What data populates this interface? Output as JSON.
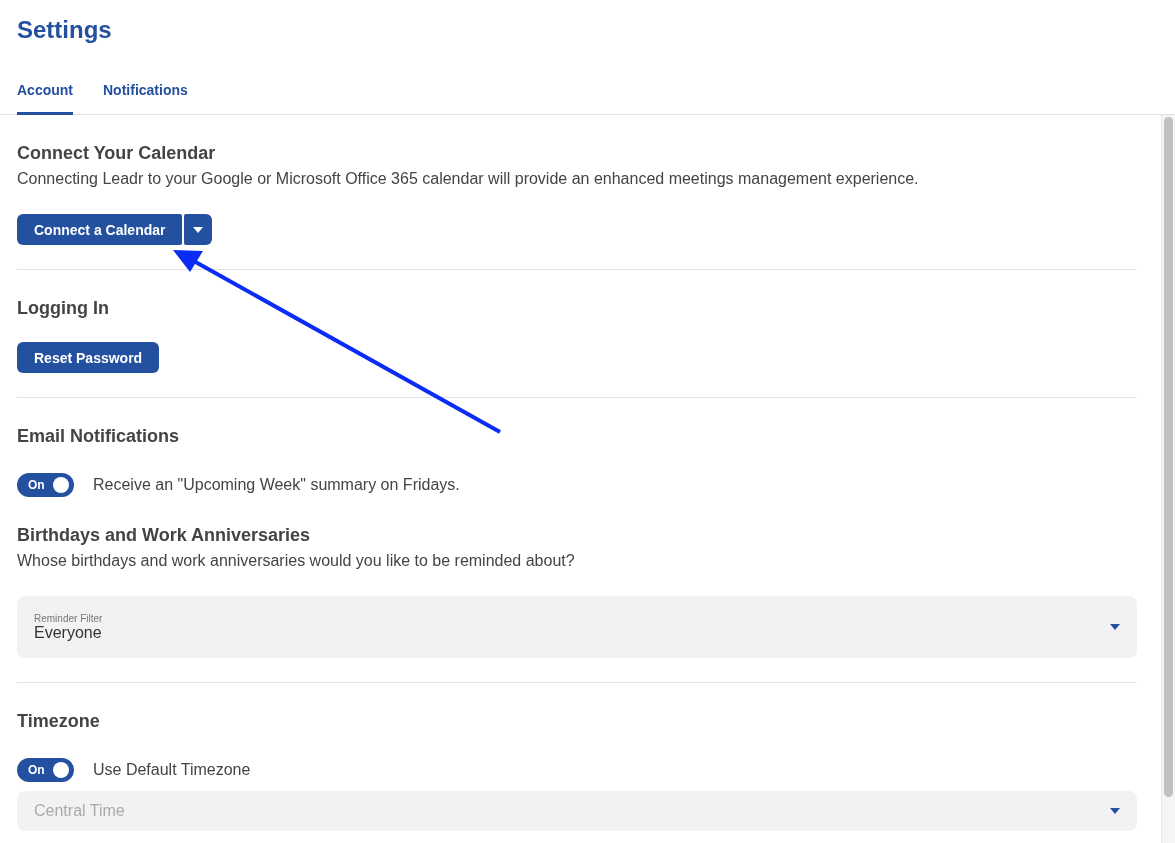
{
  "page": {
    "title": "Settings"
  },
  "tabs": [
    {
      "label": "Account",
      "selected": true
    },
    {
      "label": "Notifications",
      "selected": false
    }
  ],
  "calendar": {
    "heading": "Connect Your Calendar",
    "description": "Connecting Leadr to your Google or Microsoft Office 365 calendar will provide an enhanced meetings management experience.",
    "button": "Connect a Calendar"
  },
  "logging_in": {
    "heading": "Logging In",
    "button": "Reset Password"
  },
  "email_notifications": {
    "heading": "Email Notifications",
    "toggle": {
      "label": "On",
      "on": true
    },
    "toggle_text": "Receive an \"Upcoming Week\" summary on Fridays."
  },
  "birthdays": {
    "heading": "Birthdays and Work Anniversaries",
    "description": "Whose birthdays and work anniversaries would you like to be reminded about?",
    "field": {
      "label": "Reminder Filter",
      "value": "Everyone",
      "disabled": false
    }
  },
  "timezone": {
    "heading": "Timezone",
    "toggle": {
      "label": "On",
      "on": true
    },
    "toggle_text": "Use Default Timezone",
    "field": {
      "value": "Central Time",
      "disabled": true
    }
  }
}
